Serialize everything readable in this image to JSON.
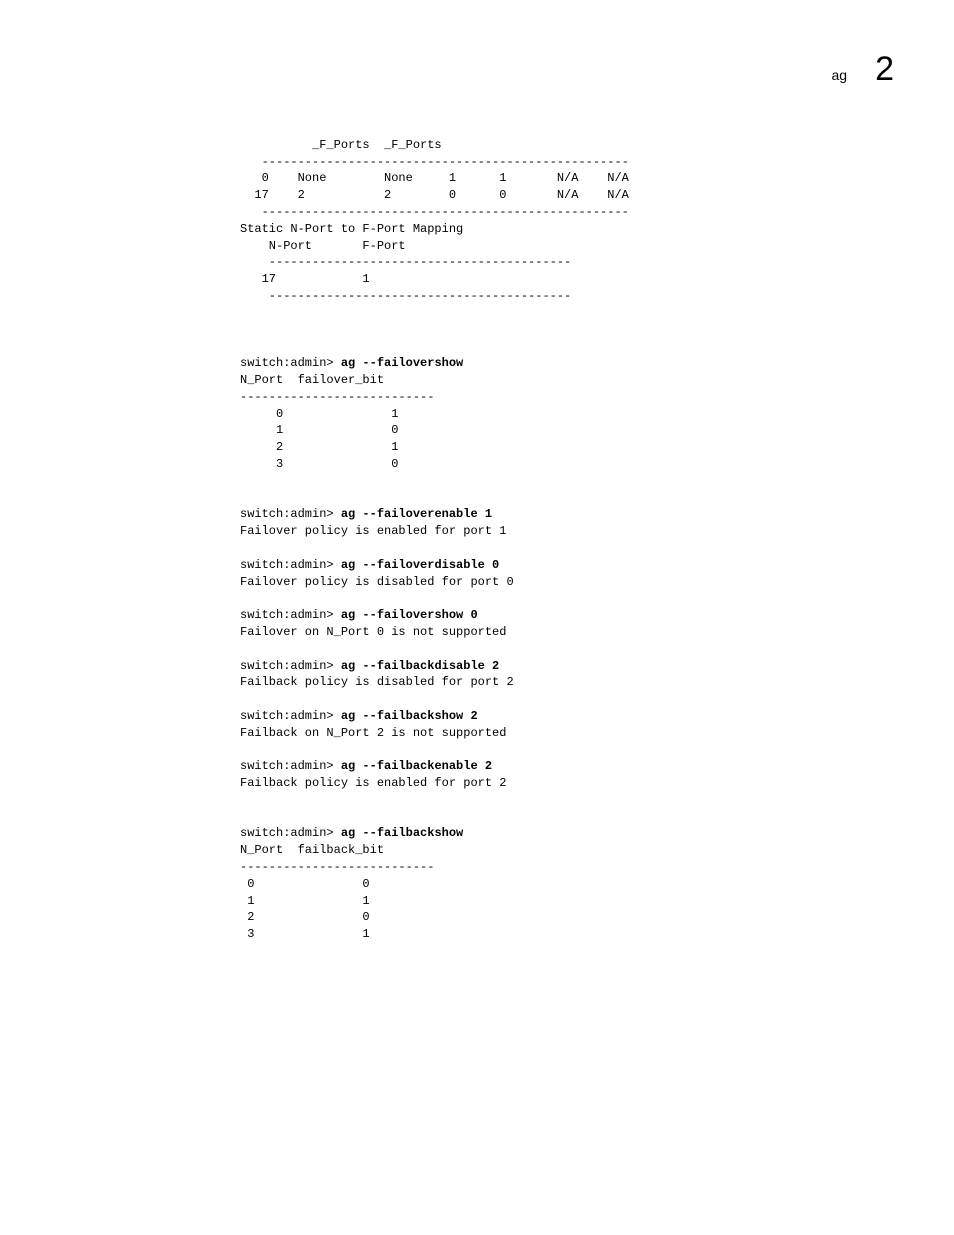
{
  "header": {
    "cmd": "ag",
    "chapter": "2"
  },
  "block1": {
    "heading_line": "          _F_Ports  _F_Ports",
    "dash1": "   ---------------------------------------------------",
    "row0": "   0    None        None     1      1       N/A    N/A",
    "row1": "  17    2           2        0      0       N/A    N/A",
    "dash2": "   ---------------------------------------------------",
    "title": "Static N-Port to F-Port Mapping",
    "cols": "    N-Port       F-Port",
    "dash3": "    ------------------------------------------",
    "map_row": "   17            1",
    "dash4": "    ------------------------------------------"
  },
  "block2": {
    "prompt": "switch:admin> ",
    "cmd": "ag --failovershow",
    "header": "N_Port  failover_bit",
    "dash": "---------------------------",
    "r0": "     0               1",
    "r1": "     1               0",
    "r2": "     2               1",
    "r3": "     3               0"
  },
  "block3": {
    "prompt": "switch:admin> ",
    "cmd1": "ag --failoverenable 1",
    "out1": "Failover policy is enabled for port 1",
    "cmd2": "ag --failoverdisable 0",
    "out2": "Failover policy is disabled for port 0",
    "cmd3": "ag --failovershow 0",
    "out3": "Failover on N_Port 0 is not supported",
    "cmd4": "ag --failbackdisable 2",
    "out4": "Failback policy is disabled for port 2",
    "cmd5": "ag --failbackshow 2",
    "out5": "Failback on N_Port 2 is not supported",
    "cmd6": "ag --failbackenable 2",
    "out6": "Failback policy is enabled for port 2"
  },
  "block4": {
    "prompt": "switch:admin> ",
    "cmd": "ag --failbackshow",
    "header": "N_Port  failback_bit",
    "dash": "---------------------------",
    "r0": " 0               0",
    "r1": " 1               1",
    "r2": " 2               0",
    "r3": " 3               1"
  }
}
